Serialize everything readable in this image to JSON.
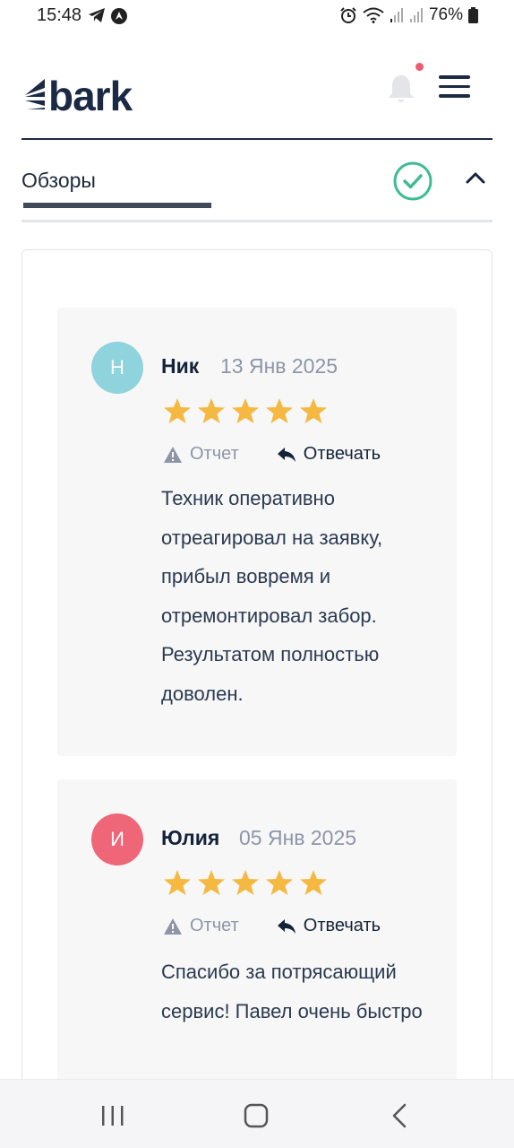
{
  "status_bar": {
    "time": "15:48",
    "battery": "76%",
    "left_icons": [
      "telegram-icon",
      "navigation-icon"
    ],
    "right_icons": [
      "alarm-icon",
      "wifi-icon",
      "signal-icon",
      "signal-icon-2",
      "battery-icon"
    ]
  },
  "header": {
    "logo_text": "bark",
    "notification_dot_color": "#ee5a6f"
  },
  "section": {
    "title": "Обзоры",
    "check_color": "#3dbb94"
  },
  "reviews": [
    {
      "initial": "Н",
      "avatar_color": "#8fd3dc",
      "name": "Ник",
      "date": "13 Янв 2025",
      "rating": 5,
      "report_label": "Отчет",
      "reply_label": "Отвечать",
      "text": "Техник оперативно отреагировал на заявку, прибыл вовремя и отремонтировал забор. Результатом полностью доволен."
    },
    {
      "initial": "И",
      "avatar_color": "#ee6677",
      "name": "Юлия",
      "date": "05 Янв 2025",
      "rating": 5,
      "report_label": "Отчет",
      "reply_label": "Отвечать",
      "text": "Спасибо за потрясающий сервис! Павел очень быстро"
    }
  ],
  "colors": {
    "star": "#f5b942",
    "brand_dark": "#1b2a44"
  }
}
